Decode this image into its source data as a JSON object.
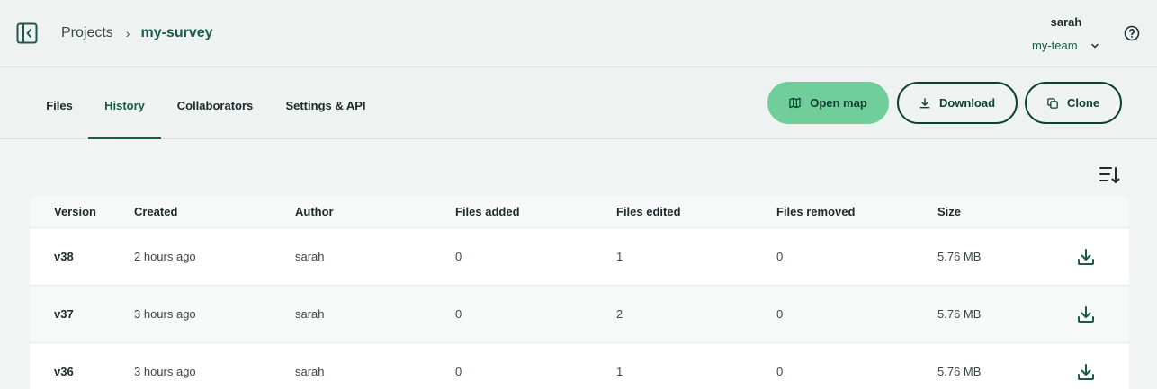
{
  "header": {
    "breadcrumb": {
      "projects_label": "Projects",
      "separator": "›",
      "current": "my-survey"
    },
    "user": {
      "name": "sarah",
      "team": "my-team"
    }
  },
  "tabs": [
    {
      "label": "Files"
    },
    {
      "label": "History",
      "active": true
    },
    {
      "label": "Collaborators"
    },
    {
      "label": "Settings & API"
    }
  ],
  "actions": {
    "open_map": "Open map",
    "download": "Download",
    "clone": "Clone"
  },
  "table": {
    "columns": [
      "Version",
      "Created",
      "Author",
      "Files added",
      "Files edited",
      "Files removed",
      "Size"
    ],
    "rows": [
      {
        "version": "v38",
        "created": "2 hours ago",
        "author": "sarah",
        "added": "0",
        "edited": "1",
        "removed": "0",
        "size": "5.76 MB"
      },
      {
        "version": "v37",
        "created": "3 hours ago",
        "author": "sarah",
        "added": "0",
        "edited": "2",
        "removed": "0",
        "size": "5.76 MB"
      },
      {
        "version": "v36",
        "created": "3 hours ago",
        "author": "sarah",
        "added": "0",
        "edited": "1",
        "removed": "0",
        "size": "5.76 MB"
      }
    ]
  },
  "colors": {
    "accent": "#1b5a4a",
    "primary_button": "#6fce99",
    "background": "#eef3f2"
  },
  "icons": [
    "sidebar-toggle-icon",
    "chevron-down-icon",
    "help-icon",
    "map-icon",
    "download-icon",
    "clone-icon",
    "sort-icon"
  ]
}
